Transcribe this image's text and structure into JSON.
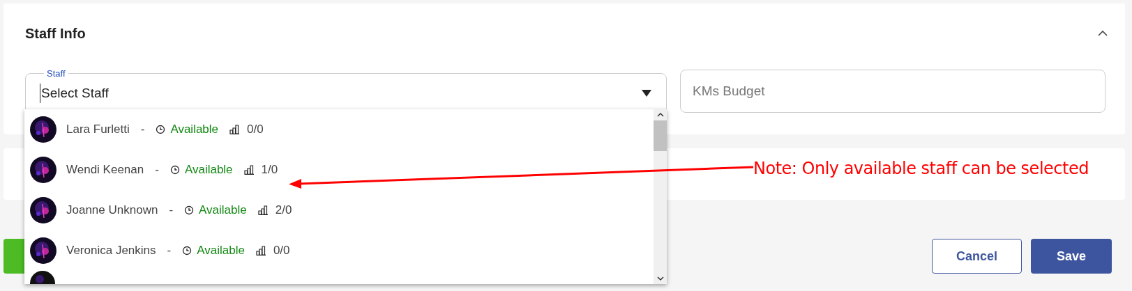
{
  "section": {
    "title": "Staff Info",
    "expanded": true
  },
  "staff_field": {
    "label": "Staff",
    "value": "Select Staff"
  },
  "kms_budget": {
    "placeholder": "KMs Budget"
  },
  "staff_options": [
    {
      "name": "Lara Furletti",
      "separator": "-",
      "status": "Available",
      "load": "0/0"
    },
    {
      "name": "Wendi Keenan",
      "separator": "-",
      "status": "Available",
      "load": "1/0"
    },
    {
      "name": "Joanne Unknown",
      "separator": "-",
      "status": "Available",
      "load": "2/0"
    },
    {
      "name": "Veronica Jenkins",
      "separator": "-",
      "status": "Available",
      "load": "0/0"
    }
  ],
  "annotation": {
    "text": "Note: Only available staff can be selected"
  },
  "buttons": [
    {
      "label": "Cancel",
      "kind": "outline"
    },
    {
      "label": "Save",
      "kind": "primary"
    }
  ]
}
